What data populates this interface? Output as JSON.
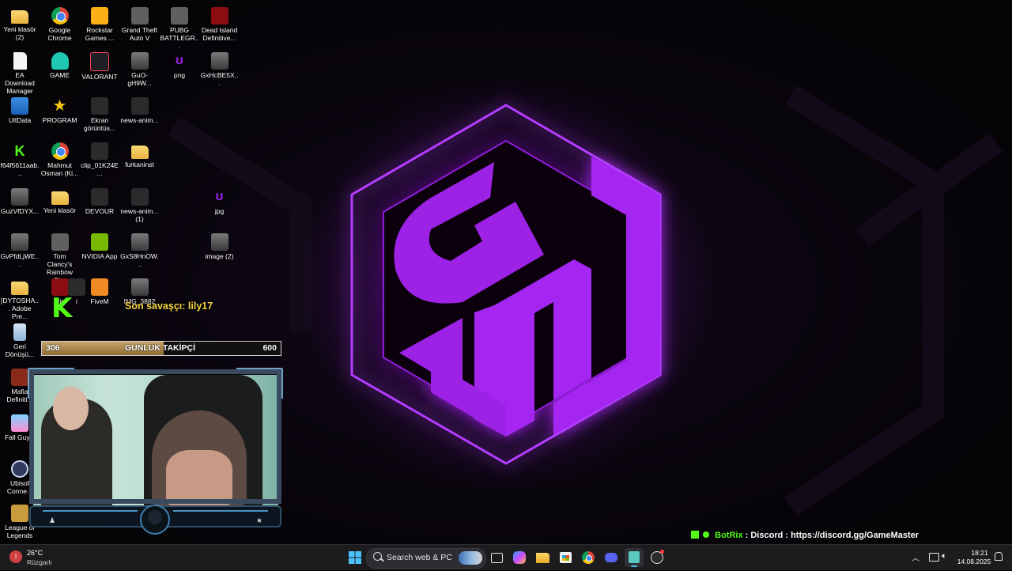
{
  "desktop": {
    "icons": [
      {
        "label": "Yeni klasör (2)",
        "icon": "folder-icon"
      },
      {
        "label": "Google Chrome",
        "icon": "chrome-icon"
      },
      {
        "label": "Rockstar Games ...",
        "icon": "rockstar-icon"
      },
      {
        "label": "Grand Theft Auto V",
        "icon": "gta-icon"
      },
      {
        "label": "PUBG BATTLEGR...",
        "icon": "pubg-icon"
      },
      {
        "label": "Dead Island Definitive...",
        "icon": "dead-island-icon"
      },
      {
        "label": "EA Download Manager",
        "icon": "document-icon"
      },
      {
        "label": "GAME",
        "icon": "person-icon"
      },
      {
        "label": "VALORANT",
        "icon": "valorant-icon"
      },
      {
        "label": "GuO-gH9W...",
        "icon": "image-icon"
      },
      {
        "label": "png",
        "icon": "png-icon"
      },
      {
        "label": "GxHcBE5X...",
        "icon": "image-icon"
      },
      {
        "label": "UltData",
        "icon": "ultdata-icon"
      },
      {
        "label": "PROGRAM",
        "icon": "star-icon"
      },
      {
        "label": "Ekran görüntüs...",
        "icon": "screenshot-icon"
      },
      {
        "label": "news-anim...",
        "icon": "video-icon"
      },
      {
        "label": "f64f5611aab...",
        "icon": "kick-icon"
      },
      {
        "label": "Mahmut Osman (Ki...",
        "icon": "chrome-icon"
      },
      {
        "label": "clip_01K24E...",
        "icon": "video-icon"
      },
      {
        "label": "furkaninst",
        "icon": "folder-icon"
      },
      {
        "label": "GuzVfDYX...",
        "icon": "image-icon"
      },
      {
        "label": "Yeni klasör",
        "icon": "folder-icon"
      },
      {
        "label": "DEVOUR",
        "icon": "devour-icon"
      },
      {
        "label": "news-anim... (1)",
        "icon": "video-icon"
      },
      {
        "label": "jpg",
        "icon": "jpg-icon"
      },
      {
        "label": "GvPfdLjWE...",
        "icon": "image-icon"
      },
      {
        "label": "Tom Clancy's Rainbow Si...",
        "icon": "rainbow-six-icon"
      },
      {
        "label": "NVIDIA App",
        "icon": "nvidia-icon"
      },
      {
        "label": "GxS8HnOW...",
        "icon": "image-icon"
      },
      {
        "label": "image (2)",
        "icon": "image-icon"
      },
      {
        "label": "[DYTOSHA... Adobe Pre...",
        "icon": "folder-icon"
      },
      {
        "label": "Ric",
        "icon": "riot-icon"
      },
      {
        "label": "i",
        "icon": "app-icon"
      },
      {
        "label": "FiveM",
        "icon": "fivem-icon"
      },
      {
        "label": "IMG_3882",
        "icon": "image-icon"
      },
      {
        "label": "Geri Dönüşü...",
        "icon": "recycle-bin-icon"
      },
      {
        "label": "Mafia Definiti...",
        "icon": "mafia-icon"
      },
      {
        "label": "Fall Guy...",
        "icon": "fall-guys-icon"
      },
      {
        "label": "Ubisof Conne...",
        "icon": "ubisoft-icon"
      },
      {
        "label": "League of Legends",
        "icon": "lol-icon"
      }
    ]
  },
  "stream_overlay": {
    "last_fighter": "Son savaşçı: lily17",
    "follower_goal": {
      "label": "GUNLÜK TAKİPÇİ",
      "current": "306",
      "target": "600",
      "progress": 0.51
    },
    "bot_message": {
      "bot": "BotRix",
      "text": ": Discord : https://discord.gg/GameMaster"
    }
  },
  "wallpaper": {
    "logo_letters": "GM",
    "accent_color": "#a020f0"
  },
  "taskbar": {
    "weather_temp": "26°C",
    "weather_text": "Rüzgarlı",
    "search_placeholder": "Search web & PC",
    "time": "18:21",
    "date": "14.08.2025",
    "pinned": [
      "start-icon",
      "search-icon",
      "task-view-icon",
      "copilot-icon",
      "file-explorer-icon",
      "store-icon",
      "chrome-icon",
      "discord-icon",
      "app-icon",
      "obs-icon"
    ]
  }
}
